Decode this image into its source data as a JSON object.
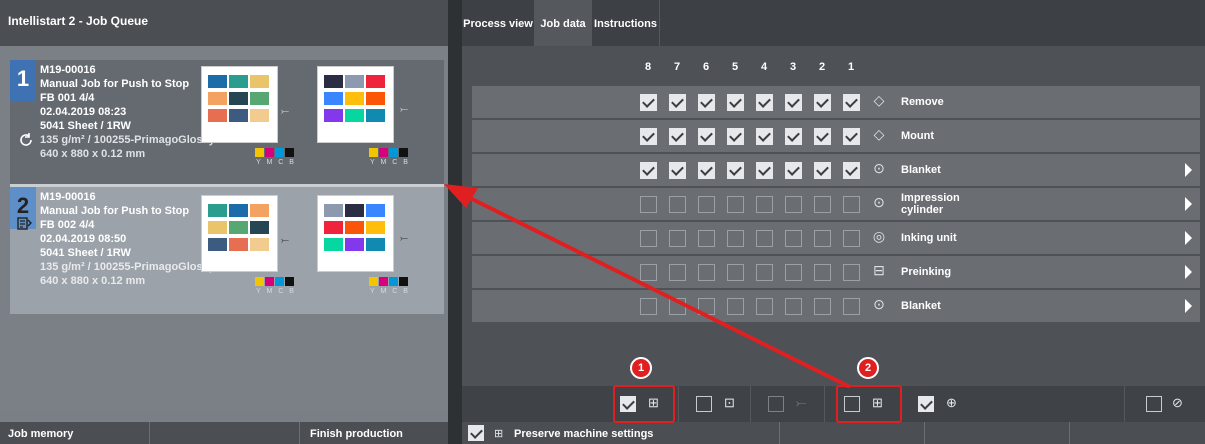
{
  "left_panel": {
    "title": "Intellistart 2 - Job Queue",
    "jobs": [
      {
        "number": "1",
        "id": "M19-00016",
        "name": "Manual Job for Push to Stop",
        "fb": "FB 001  4/4",
        "date": "02.04.2019 08:23",
        "sheet": "5041 Sheet / 1RW",
        "paper": "135 g/m²  /  100255-PrimagoGlossy-...",
        "size": "640 x 880 x 0.12 mm",
        "status_icon": "refresh-icon",
        "swatch_label": "Y M C B"
      },
      {
        "number": "2",
        "id": "M19-00016",
        "name": "Manual Job for Push to Stop",
        "fb": "FB 002  4/4",
        "date": "02.04.2019 08:50",
        "sheet": "5041 Sheet / 1RW",
        "paper": "135 g/m²  /  100255-PrimagoGlossy-...",
        "size": "640 x 880 x 0.12 mm",
        "status_icon": "job-data-icon",
        "swatch_label": "Y M C B"
      }
    ],
    "footer": {
      "job_memory": "Job memory",
      "finish_production": "Finish production"
    },
    "swatch_colors": [
      "#f2c500",
      "#d6007e",
      "#0098d8",
      "#111111"
    ]
  },
  "right_panel": {
    "tabs": [
      "Process view",
      "Job data",
      "Instructions"
    ],
    "active_tab": "Job data",
    "column_numbers": [
      "8",
      "7",
      "6",
      "5",
      "4",
      "3",
      "2",
      "1"
    ],
    "rows": [
      {
        "label": "Remove",
        "icon": "remove-plate-icon",
        "checked": true,
        "has_arrow": false
      },
      {
        "label": "Mount",
        "icon": "mount-plate-icon",
        "checked": true,
        "has_arrow": false
      },
      {
        "label": "Blanket",
        "icon": "blanket-wash-icon",
        "checked": true,
        "has_arrow": true
      },
      {
        "label": "Impression\ncylinder",
        "icon": "impression-cylinder-icon",
        "checked": false,
        "has_arrow": true
      },
      {
        "label": "Inking unit",
        "icon": "inking-unit-icon",
        "checked": false,
        "has_arrow": true
      },
      {
        "label": "Preinking",
        "icon": "preinking-icon",
        "checked": false,
        "has_arrow": true
      },
      {
        "label": "Blanket",
        "icon": "blanket-icon",
        "checked": false,
        "has_arrow": true
      }
    ],
    "toolbar": {
      "items": [
        {
          "name": "push-to-stop",
          "checked": true,
          "icon": "push-to-stop-icon",
          "enabled": true
        },
        {
          "name": "sheet-option",
          "checked": false,
          "icon": "sheet-option-icon",
          "enabled": true
        },
        {
          "name": "disabled-option",
          "checked": false,
          "icon": "disabled-option-icon",
          "enabled": false
        },
        {
          "name": "autostart",
          "checked": false,
          "icon": "autostart-icon",
          "enabled": true
        },
        {
          "name": "remote-option",
          "checked": true,
          "icon": "remote-icon",
          "enabled": true
        },
        {
          "name": "safety-option",
          "checked": false,
          "icon": "safety-icon",
          "enabled": true
        }
      ]
    },
    "footer": {
      "preserve_checked": true,
      "preserve_label": "Preserve machine settings"
    }
  },
  "annotations": {
    "badge_1": "1",
    "badge_2": "2",
    "color": "#e02020"
  }
}
